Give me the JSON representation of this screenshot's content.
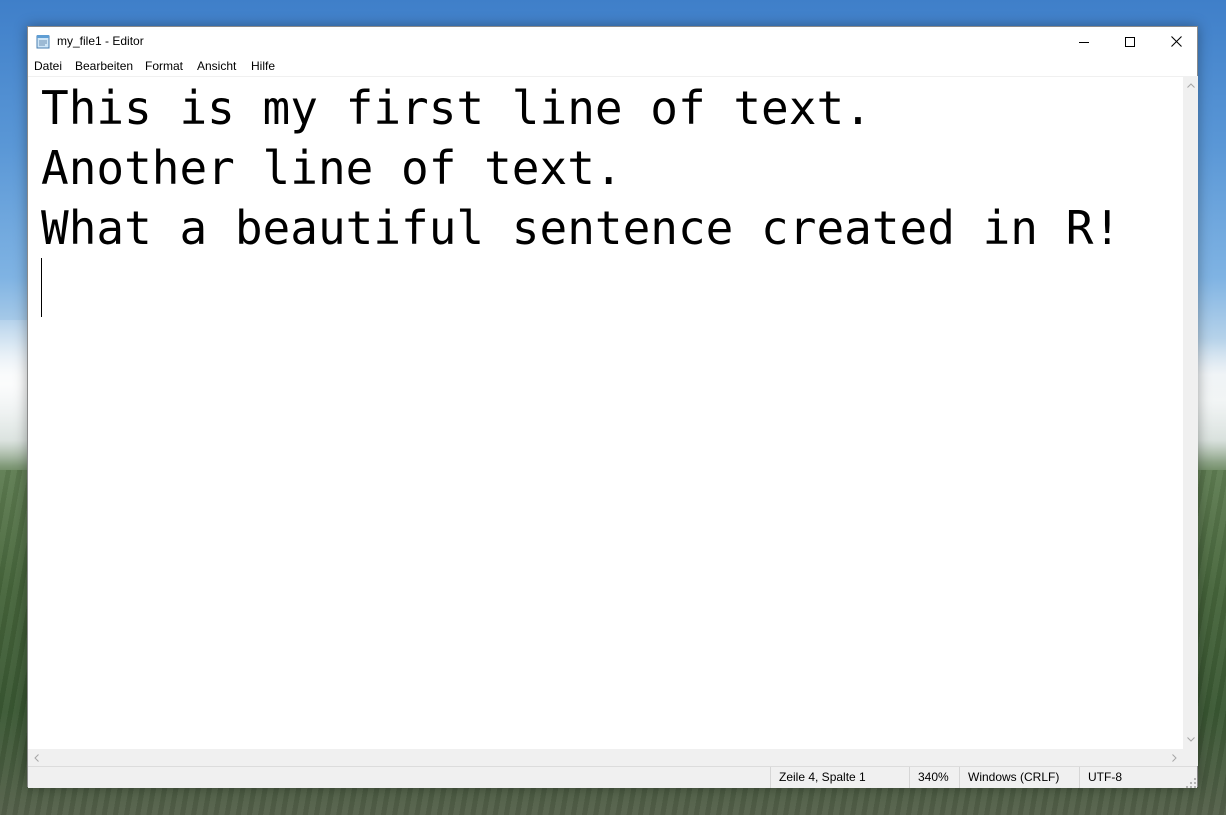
{
  "desktop": {
    "wallpaper": "landscape"
  },
  "window": {
    "title": "my_file1 - Editor",
    "app_icon": "notepad-icon",
    "caption_buttons": {
      "minimize_icon": "minimize-icon",
      "maximize_icon": "maximize-icon",
      "close_icon": "close-icon"
    }
  },
  "menubar": {
    "items": [
      {
        "label": "Datei"
      },
      {
        "label": "Bearbeiten"
      },
      {
        "label": "Format"
      },
      {
        "label": "Ansicht"
      },
      {
        "label": "Hilfe"
      }
    ]
  },
  "editor": {
    "lines": [
      "This is my first line of text.",
      "Another line of text.",
      "What a beautiful sentence created in R!"
    ]
  },
  "statusbar": {
    "position": "Zeile 4, Spalte 1",
    "zoom": "340%",
    "line_ending": "Windows (CRLF)",
    "encoding": "UTF-8"
  },
  "colors": {
    "text": "#000000",
    "window_bg": "#ffffff",
    "chrome_bg": "#f0f0f0"
  }
}
